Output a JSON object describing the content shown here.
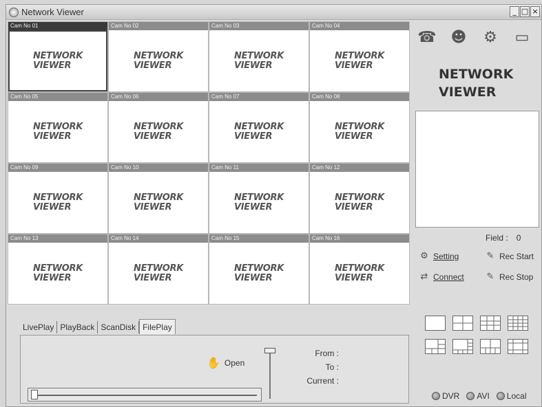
{
  "window": {
    "title": "Network Viewer",
    "controls": [
      "_",
      "□",
      "×"
    ]
  },
  "cameras": [
    {
      "label": "Cam No 01"
    },
    {
      "label": "Cam No 02"
    },
    {
      "label": "Cam No 03"
    },
    {
      "label": "Cam No 04"
    },
    {
      "label": "Cam No 05"
    },
    {
      "label": "Cam No 06"
    },
    {
      "label": "Cam No 07"
    },
    {
      "label": "Cam No 08"
    },
    {
      "label": "Cam No 09"
    },
    {
      "label": "Cam No 10"
    },
    {
      "label": "Cam No 11"
    },
    {
      "label": "Cam No 12"
    },
    {
      "label": "Cam No 13"
    },
    {
      "label": "Cam No 14"
    },
    {
      "label": "Cam No 15"
    },
    {
      "label": "Cam No 16"
    }
  ],
  "camera_logo": {
    "line1": "NETWORK",
    "line2": "VIEWER"
  },
  "selected_camera": "Cam No 01",
  "right_panel": {
    "toolbar_icons": [
      "fax-icon",
      "person-icon",
      "cd-settings-icon",
      "dvr-icon"
    ],
    "brand_line1": "NETWORK",
    "brand_line2": "VIEWER",
    "field_label": "Field :",
    "field_value": "0",
    "setting_label": "Setting",
    "connect_label": "Connect",
    "rec_start_label": "Rec Start",
    "rec_stop_label": "Rec Stop",
    "source_options": [
      "DVR",
      "AVI",
      "Local"
    ]
  },
  "tabs": [
    "LivePlay",
    "PlayBack",
    "ScanDisk",
    "FilePlay"
  ],
  "active_tab": "FilePlay",
  "fileplay": {
    "open_label": "Open",
    "from_label": "From :",
    "to_label": "To :",
    "current_label": "Current :"
  }
}
